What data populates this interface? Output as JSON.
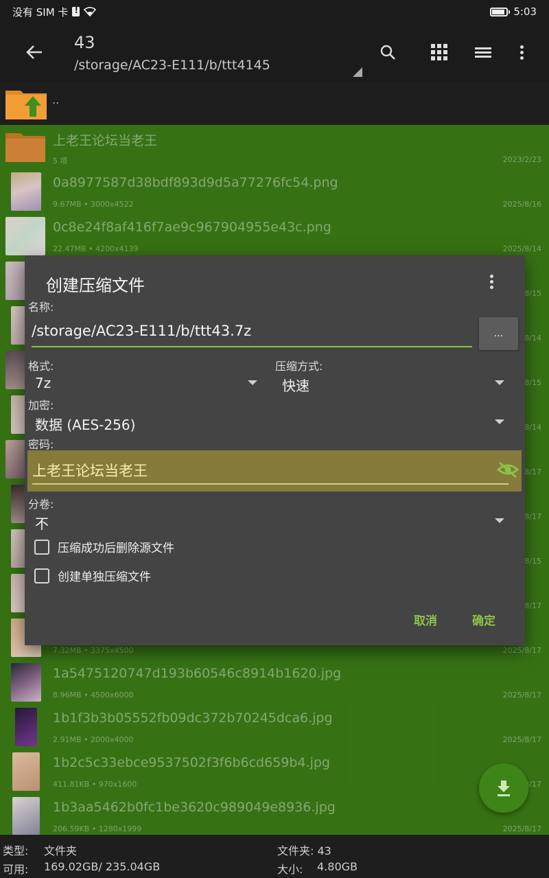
{
  "status_bar": {
    "carrier": "没有 SIM 卡",
    "time": "5:03"
  },
  "app_bar": {
    "title": "43",
    "path": "/storage/AC23-E111/b/ttt4145"
  },
  "parent": {
    "label": ".."
  },
  "files": [
    {
      "name": "上老王论坛当老王",
      "meta": "5 项",
      "date": "2023/2/23",
      "type": "folder"
    },
    {
      "name": "0a8977587d38bdf893d9d5a77276fc54.png",
      "meta": "9.67MB  • 3000x4522",
      "date": "2025/8/16",
      "type": "image"
    },
    {
      "name": "0c8e24f8af416f7ae9c967904955e43c.png",
      "meta": "22.47MB  • 4200x4139",
      "date": "2025/8/14",
      "type": "image"
    },
    {
      "name": "",
      "meta": "",
      "date": "2025/8/15",
      "type": "image"
    },
    {
      "name": "",
      "meta": "",
      "date": "2025/8/14",
      "type": "image"
    },
    {
      "name": "",
      "meta": "",
      "date": "2025/8/15",
      "type": "image"
    },
    {
      "name": "",
      "meta": "",
      "date": "2025/8/14",
      "type": "image"
    },
    {
      "name": "",
      "meta": "",
      "date": "2025/8/17",
      "type": "image"
    },
    {
      "name": "",
      "meta": "",
      "date": "2025/8/17",
      "type": "image"
    },
    {
      "name": "",
      "meta": "",
      "date": "2025/8/15",
      "type": "image"
    },
    {
      "name": "",
      "meta": "",
      "date": "2025/8/17",
      "type": "image"
    },
    {
      "name": "",
      "meta": "7.32MB  • 3375x4500",
      "date": "2025/8/17",
      "type": "image"
    },
    {
      "name": "1a5475120747d193b60546c8914b1620.jpg",
      "meta": "8.96MB  • 4500x6000",
      "date": "2025/8/17",
      "type": "image"
    },
    {
      "name": "1b1f3b3b05552fb09dc372b70245dca6.jpg",
      "meta": "2.91MB  • 2000x4000",
      "date": "2025/8/17",
      "type": "image"
    },
    {
      "name": "1b2c5c33ebce9537502f3f6b6cd659b4.jpg",
      "meta": "411.81KB  • 970x1600",
      "date": "2025/8/17",
      "type": "image"
    },
    {
      "name": "1b3aa5462b0fc1be3620c989049e8936.jpg",
      "meta": "206.59KB  • 1280x1999",
      "date": "2025/8/17",
      "type": "image"
    }
  ],
  "info_bar": {
    "type_label": "类型:",
    "type_value": "文件夹",
    "avail_label": "可用:",
    "avail_value": "169.02GB/ 235.04GB",
    "folder_label": "文件夹: 43",
    "size_label": "大小:",
    "size_value": "4.80GB"
  },
  "dialog": {
    "title": "创建压缩文件",
    "name_label": "名称:",
    "name_value": "/storage/AC23-E111/b/ttt43.7z",
    "browse_label": "...",
    "format_label": "格式:",
    "format_value": "7z",
    "method_label": "压缩方式:",
    "method_value": "快速",
    "encrypt_label": "加密:",
    "encrypt_value": "数据 (AES-256)",
    "password_label": "密码:",
    "password_value": "上老王论坛当老王",
    "split_label": "分卷:",
    "split_value": "不",
    "delete_source_label": "压缩成功后删除源文件",
    "separate_archive_label": "创建单独压缩文件",
    "cancel_label": "取消",
    "ok_label": "确定"
  },
  "colors": {
    "accent": "#8bc34a",
    "list_bg": "#3a7a16",
    "dialog_bg": "#444444",
    "password_bg": "#857b3a"
  }
}
